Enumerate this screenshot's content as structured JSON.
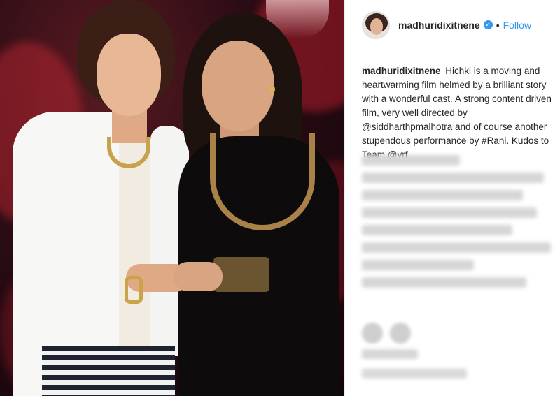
{
  "header": {
    "username": "madhuridixitnene",
    "verified_icon": "✓",
    "separator": "•",
    "follow_label": "Follow"
  },
  "caption": {
    "username": "madhuridixitnene",
    "text": "Hichki is a moving and heartwarming film helmed by a brilliant story with a wonderful cast. A strong content driven film, very well directed by @siddharthpmalhotra and of course another stupendous performance by #Rani. Kudos to Team @yrf"
  },
  "colors": {
    "link": "#3897f0",
    "text": "#262626",
    "verified": "#3897f0"
  }
}
